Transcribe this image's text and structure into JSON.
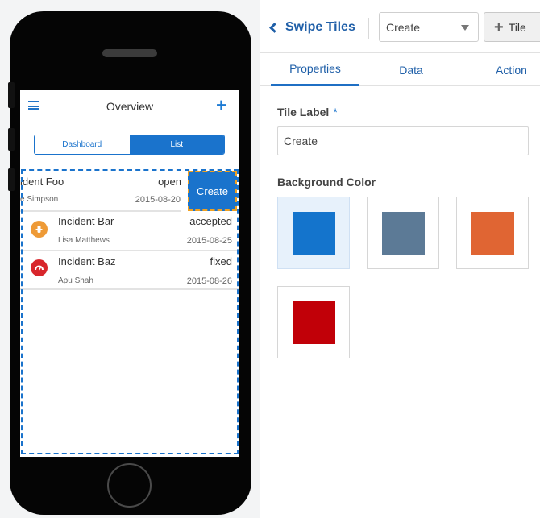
{
  "phone_app": {
    "title": "Overview",
    "segments": [
      "Dashboard",
      "List"
    ],
    "active_segment": "List",
    "items": [
      {
        "title": "ident Foo",
        "status": "open",
        "assignee": "e Simpson",
        "date": "2015-08-20"
      },
      {
        "title": "Incident Bar",
        "status": "accepted",
        "assignee": "Lisa Matthews",
        "date": "2015-08-25",
        "icon": "fire-hydrant-icon",
        "icon_color": "#ee9a36"
      },
      {
        "title": "Incident Baz",
        "status": "fixed",
        "assignee": "Apu Shah",
        "date": "2015-08-26",
        "icon": "gauge-icon",
        "icon_color": "#d8262c"
      }
    ],
    "swipe_tile_label": "Create"
  },
  "panel": {
    "back_label": "Swipe Tiles",
    "select_value": "Create",
    "add_tile_label": "Tile",
    "tabs": [
      "Properties",
      "Data",
      "Action"
    ],
    "active_tab": "Properties",
    "tile_label_field": {
      "label": "Tile Label",
      "required_marker": "*",
      "value": "Create"
    },
    "background_color": {
      "label": "Background Color",
      "selected": "#1474cc",
      "swatches": [
        "#1474cc",
        "#5c7a96",
        "#e06533",
        "#c10008"
      ]
    }
  }
}
